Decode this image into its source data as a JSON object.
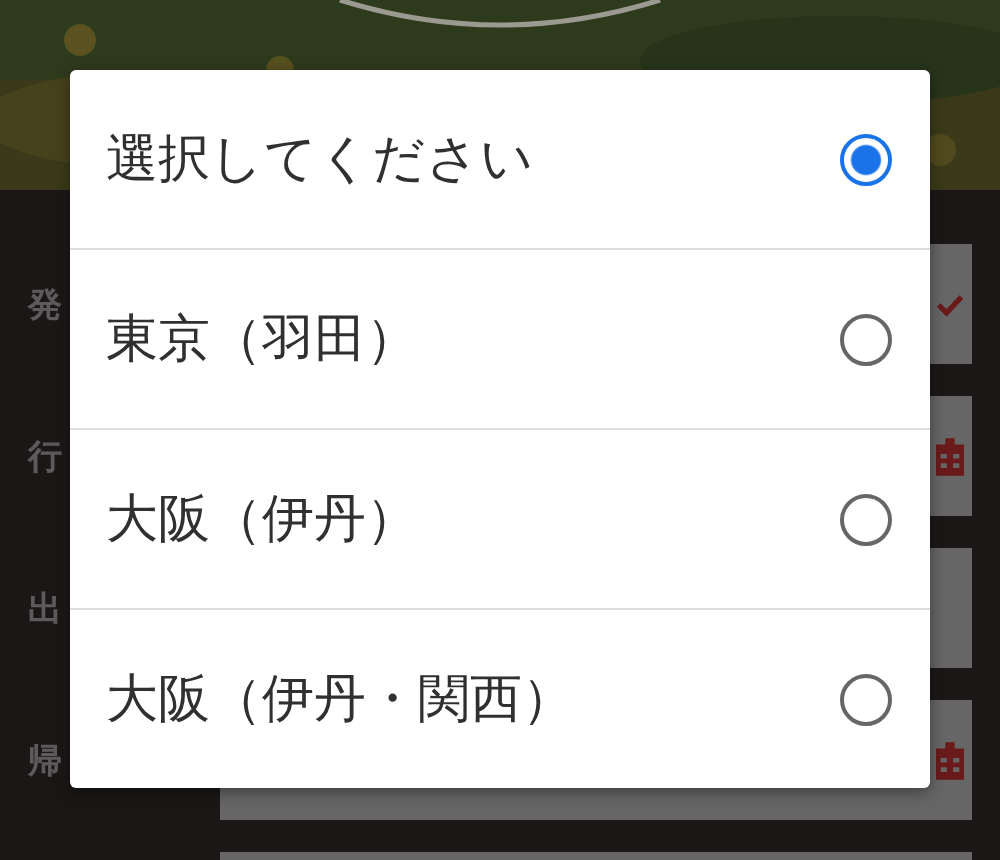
{
  "form": {
    "rows": [
      {
        "label": "発",
        "kind": "check"
      },
      {
        "label": "行",
        "kind": "calendar"
      },
      {
        "label": "出",
        "kind": "plain"
      },
      {
        "label": "帰",
        "kind": "calendar"
      },
      {
        "kind": "plain"
      }
    ]
  },
  "dialog": {
    "options": [
      {
        "label": "選択してください",
        "selected": true
      },
      {
        "label": "東京（羽田）",
        "selected": false
      },
      {
        "label": "大阪（伊丹）",
        "selected": false
      },
      {
        "label": "大阪（伊丹・関西）",
        "selected": false
      }
    ]
  }
}
